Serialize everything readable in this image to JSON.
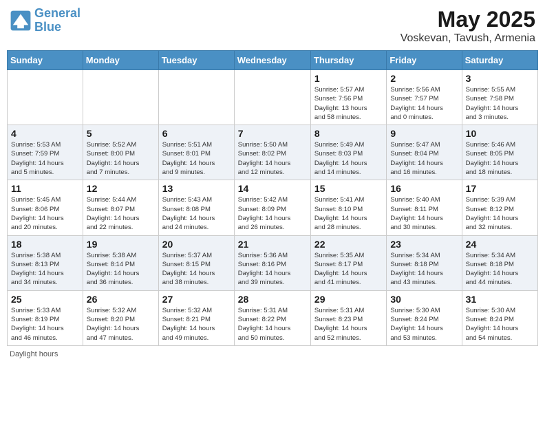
{
  "header": {
    "logo_line1": "General",
    "logo_line2": "Blue",
    "month_year": "May 2025",
    "location": "Voskevan, Tavush, Armenia"
  },
  "weekdays": [
    "Sunday",
    "Monday",
    "Tuesday",
    "Wednesday",
    "Thursday",
    "Friday",
    "Saturday"
  ],
  "weeks": [
    [
      {
        "day": "",
        "info": ""
      },
      {
        "day": "",
        "info": ""
      },
      {
        "day": "",
        "info": ""
      },
      {
        "day": "",
        "info": ""
      },
      {
        "day": "1",
        "info": "Sunrise: 5:57 AM\nSunset: 7:56 PM\nDaylight: 13 hours\nand 58 minutes."
      },
      {
        "day": "2",
        "info": "Sunrise: 5:56 AM\nSunset: 7:57 PM\nDaylight: 14 hours\nand 0 minutes."
      },
      {
        "day": "3",
        "info": "Sunrise: 5:55 AM\nSunset: 7:58 PM\nDaylight: 14 hours\nand 3 minutes."
      }
    ],
    [
      {
        "day": "4",
        "info": "Sunrise: 5:53 AM\nSunset: 7:59 PM\nDaylight: 14 hours\nand 5 minutes."
      },
      {
        "day": "5",
        "info": "Sunrise: 5:52 AM\nSunset: 8:00 PM\nDaylight: 14 hours\nand 7 minutes."
      },
      {
        "day": "6",
        "info": "Sunrise: 5:51 AM\nSunset: 8:01 PM\nDaylight: 14 hours\nand 9 minutes."
      },
      {
        "day": "7",
        "info": "Sunrise: 5:50 AM\nSunset: 8:02 PM\nDaylight: 14 hours\nand 12 minutes."
      },
      {
        "day": "8",
        "info": "Sunrise: 5:49 AM\nSunset: 8:03 PM\nDaylight: 14 hours\nand 14 minutes."
      },
      {
        "day": "9",
        "info": "Sunrise: 5:47 AM\nSunset: 8:04 PM\nDaylight: 14 hours\nand 16 minutes."
      },
      {
        "day": "10",
        "info": "Sunrise: 5:46 AM\nSunset: 8:05 PM\nDaylight: 14 hours\nand 18 minutes."
      }
    ],
    [
      {
        "day": "11",
        "info": "Sunrise: 5:45 AM\nSunset: 8:06 PM\nDaylight: 14 hours\nand 20 minutes."
      },
      {
        "day": "12",
        "info": "Sunrise: 5:44 AM\nSunset: 8:07 PM\nDaylight: 14 hours\nand 22 minutes."
      },
      {
        "day": "13",
        "info": "Sunrise: 5:43 AM\nSunset: 8:08 PM\nDaylight: 14 hours\nand 24 minutes."
      },
      {
        "day": "14",
        "info": "Sunrise: 5:42 AM\nSunset: 8:09 PM\nDaylight: 14 hours\nand 26 minutes."
      },
      {
        "day": "15",
        "info": "Sunrise: 5:41 AM\nSunset: 8:10 PM\nDaylight: 14 hours\nand 28 minutes."
      },
      {
        "day": "16",
        "info": "Sunrise: 5:40 AM\nSunset: 8:11 PM\nDaylight: 14 hours\nand 30 minutes."
      },
      {
        "day": "17",
        "info": "Sunrise: 5:39 AM\nSunset: 8:12 PM\nDaylight: 14 hours\nand 32 minutes."
      }
    ],
    [
      {
        "day": "18",
        "info": "Sunrise: 5:38 AM\nSunset: 8:13 PM\nDaylight: 14 hours\nand 34 minutes."
      },
      {
        "day": "19",
        "info": "Sunrise: 5:38 AM\nSunset: 8:14 PM\nDaylight: 14 hours\nand 36 minutes."
      },
      {
        "day": "20",
        "info": "Sunrise: 5:37 AM\nSunset: 8:15 PM\nDaylight: 14 hours\nand 38 minutes."
      },
      {
        "day": "21",
        "info": "Sunrise: 5:36 AM\nSunset: 8:16 PM\nDaylight: 14 hours\nand 39 minutes."
      },
      {
        "day": "22",
        "info": "Sunrise: 5:35 AM\nSunset: 8:17 PM\nDaylight: 14 hours\nand 41 minutes."
      },
      {
        "day": "23",
        "info": "Sunrise: 5:34 AM\nSunset: 8:18 PM\nDaylight: 14 hours\nand 43 minutes."
      },
      {
        "day": "24",
        "info": "Sunrise: 5:34 AM\nSunset: 8:18 PM\nDaylight: 14 hours\nand 44 minutes."
      }
    ],
    [
      {
        "day": "25",
        "info": "Sunrise: 5:33 AM\nSunset: 8:19 PM\nDaylight: 14 hours\nand 46 minutes."
      },
      {
        "day": "26",
        "info": "Sunrise: 5:32 AM\nSunset: 8:20 PM\nDaylight: 14 hours\nand 47 minutes."
      },
      {
        "day": "27",
        "info": "Sunrise: 5:32 AM\nSunset: 8:21 PM\nDaylight: 14 hours\nand 49 minutes."
      },
      {
        "day": "28",
        "info": "Sunrise: 5:31 AM\nSunset: 8:22 PM\nDaylight: 14 hours\nand 50 minutes."
      },
      {
        "day": "29",
        "info": "Sunrise: 5:31 AM\nSunset: 8:23 PM\nDaylight: 14 hours\nand 52 minutes."
      },
      {
        "day": "30",
        "info": "Sunrise: 5:30 AM\nSunset: 8:24 PM\nDaylight: 14 hours\nand 53 minutes."
      },
      {
        "day": "31",
        "info": "Sunrise: 5:30 AM\nSunset: 8:24 PM\nDaylight: 14 hours\nand 54 minutes."
      }
    ]
  ],
  "footer": {
    "daylight_label": "Daylight hours"
  }
}
